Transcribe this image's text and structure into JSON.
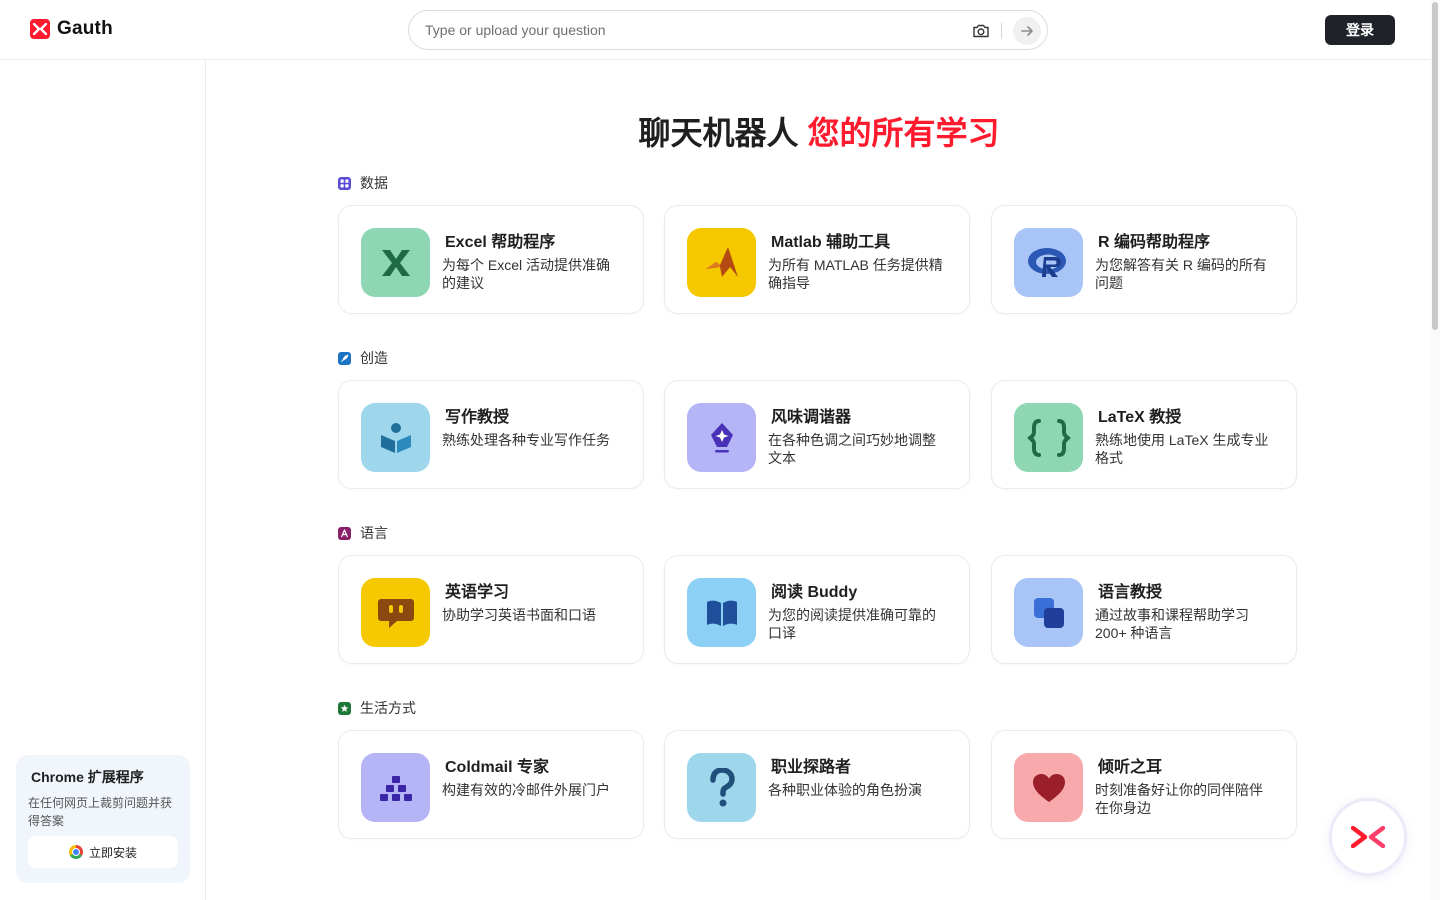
{
  "header": {
    "brand": "Gauth",
    "search_placeholder": "Type or upload your question",
    "login_label": "登录"
  },
  "sidebar": {
    "extension_title": "Chrome 扩展程序",
    "extension_desc": "在任何网页上裁剪问题并获得答案",
    "install_label": "立即安装"
  },
  "hero": {
    "title_part1": "聊天机器人 ",
    "title_part2": "您的所有学习"
  },
  "colors": {
    "brand_red": "#ff1a2d",
    "dark_button": "#1f2329"
  },
  "sections": [
    {
      "label": "数据",
      "icon": "grid-icon",
      "cards": [
        {
          "title": "Excel 帮助程序",
          "desc": "为每个 Excel 活动提供准确的建议",
          "icon": "excel-icon",
          "bg": "#8fd6b5"
        },
        {
          "title": "Matlab 辅助工具",
          "desc": "为所有 MATLAB 任务提供精确指导",
          "icon": "matlab-icon",
          "bg": "#f5c800"
        },
        {
          "title": "R 编码帮助程序",
          "desc": "为您解答有关 R 编码的所有问题",
          "icon": "r-icon",
          "bg": "#a9c4f7"
        }
      ]
    },
    {
      "label": "创造",
      "icon": "feather-icon",
      "cards": [
        {
          "title": "写作教授",
          "desc": "熟练处理各种专业写作任务",
          "icon": "reader-icon",
          "bg": "#9ed6ec"
        },
        {
          "title": "风味调谐器",
          "desc": "在各种色调之间巧妙地调整文本",
          "icon": "pen-nib-icon",
          "bg": "#b4b4f6"
        },
        {
          "title": "LaTeX 教授",
          "desc": "熟练地使用 LaTeX 生成专业格式",
          "icon": "braces-icon",
          "bg": "#8fd6b5"
        }
      ]
    },
    {
      "label": "语言",
      "icon": "letter-a-icon",
      "cards": [
        {
          "title": "英语学习",
          "desc": "协助学习英语书面和口语",
          "icon": "speech-bubble-icon",
          "bg": "#f5c800"
        },
        {
          "title": "阅读 Buddy",
          "desc": "为您的阅读提供准确可靠的口译",
          "icon": "book-icon",
          "bg": "#8cd0f5"
        },
        {
          "title": "语言教授",
          "desc": "通过故事和课程帮助学习 200+ 种语言",
          "icon": "layers-icon",
          "bg": "#a9c4f7"
        }
      ]
    },
    {
      "label": "生活方式",
      "icon": "star-icon",
      "cards": [
        {
          "title": "Coldmail 专家",
          "desc": "构建有效的冷邮件外展门户",
          "icon": "pyramid-icon",
          "bg": "#b4b4f6"
        },
        {
          "title": "职业探路者",
          "desc": "各种职业体验的角色扮演",
          "icon": "question-icon",
          "bg": "#9ed6ec"
        },
        {
          "title": "倾听之耳",
          "desc": "时刻准备好让你的同伴陪伴在你身边",
          "icon": "heart-icon",
          "bg": "#f7a9ac"
        }
      ]
    }
  ]
}
